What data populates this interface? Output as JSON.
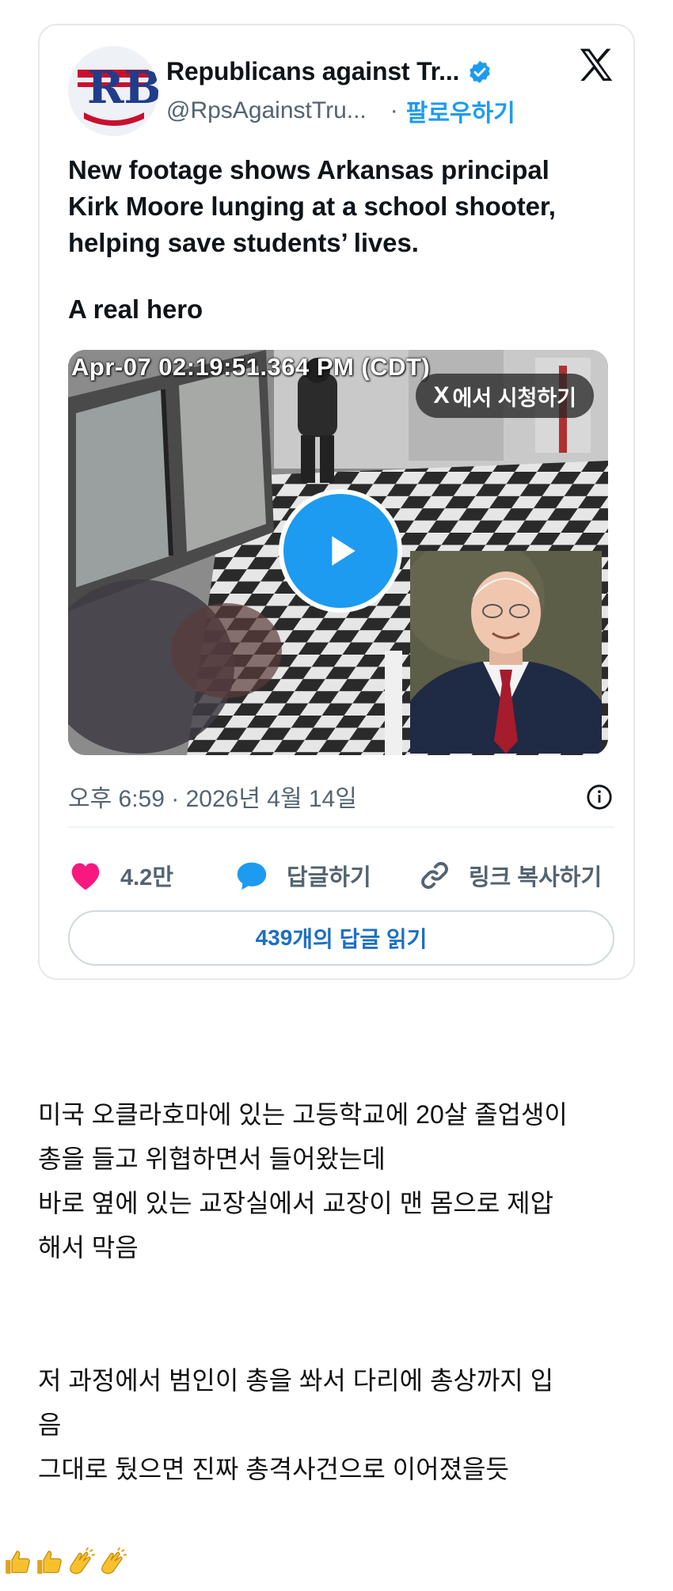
{
  "tweet": {
    "display_name": "Republicans against Tr...",
    "avatar_text": "RB",
    "handle": "@RpsAgainstTru...",
    "separator": "·",
    "follow_label": "팔로우하기",
    "text_lines": [
      "New footage shows Arkansas principal",
      "Kirk Moore lunging at a school shooter,",
      "helping save students’ lives."
    ],
    "text_line_2": "A real hero",
    "video": {
      "timestamp_overlay": "Apr-07 02:19:51.364 PM (CDT)",
      "watch_x": "X",
      "watch_label": "에서 시청하기"
    },
    "posted_at": "오후 6:59 · 2026년 4월 14일",
    "likes": "4.2만",
    "reply_label": "답글하기",
    "copy_link_label": "링크 복사하기",
    "read_replies_count": "439",
    "read_replies_label": "개의 답글 읽기"
  },
  "caption": {
    "lines_1": [
      "미국 오클라호마에 있는 고등학교에 20살 졸업생이",
      "총을 들고 위협하면서 들어왔는데",
      "바로 옆에 있는 교장실에서 교장이 맨 몸으로 제압",
      "해서 막음"
    ],
    "lines_2": [
      "저 과정에서 범인이 총을 쏴서 다리에 총상까지 입",
      "음",
      "그대로 뒀으면 진짜 총격사건으로 이어졌을듯"
    ]
  },
  "colors": {
    "accent": "#1d9bf0",
    "like_heart": "#f91880",
    "muted_text": "#536471"
  },
  "icons": [
    "verified-badge-icon",
    "x-logo-icon",
    "play-icon",
    "info-icon",
    "heart-icon",
    "reply-bubble-icon",
    "link-icon",
    "thumbs-up-icon",
    "clapping-hands-icon"
  ]
}
